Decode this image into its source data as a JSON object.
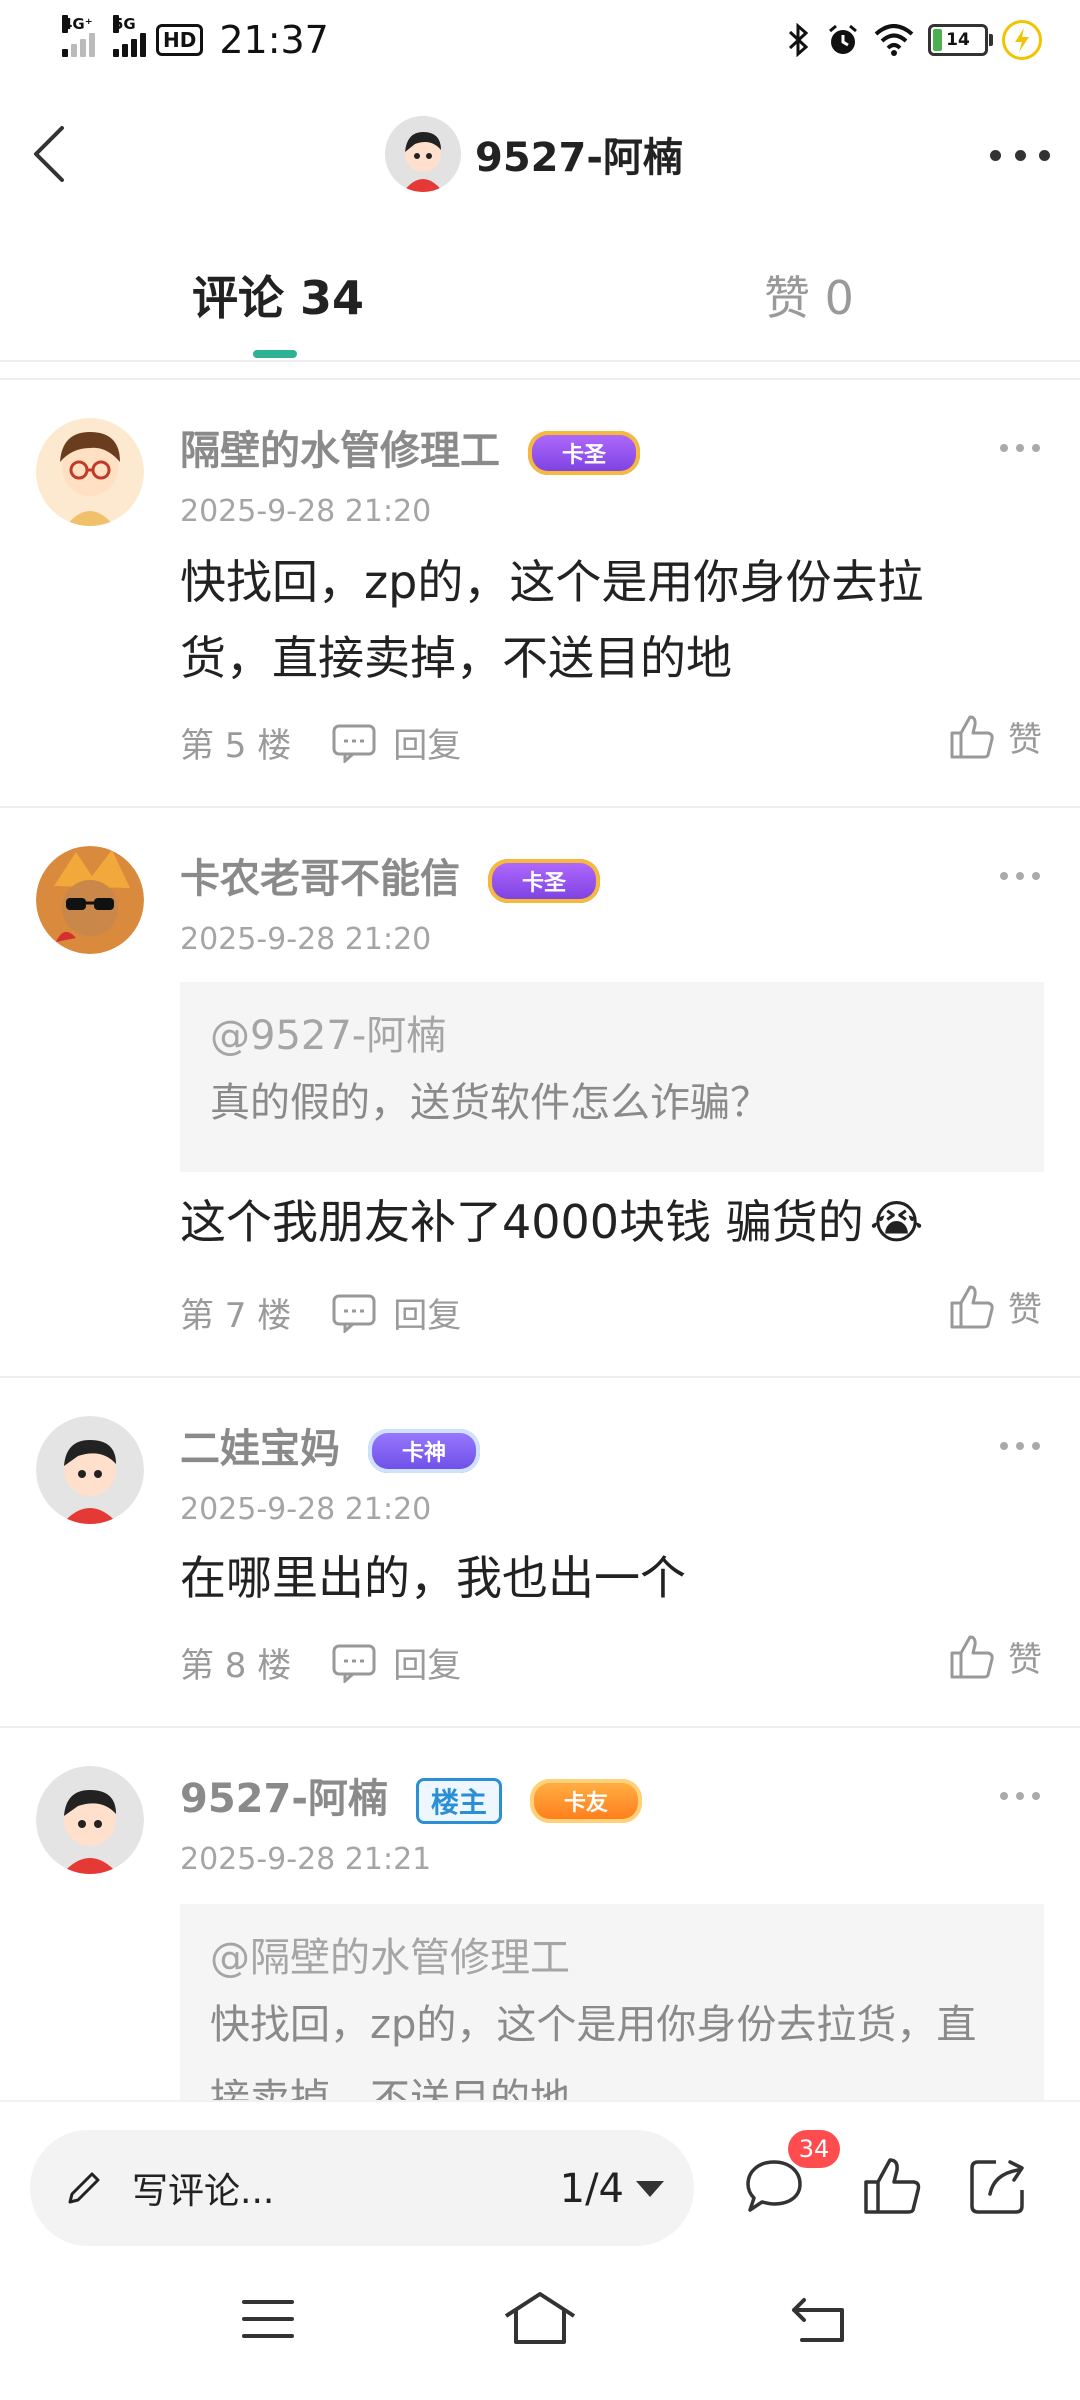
{
  "status_bar": {
    "net1": "4G⁺",
    "net2": "5G",
    "hd": "HD",
    "time": "21:37",
    "battery": "14"
  },
  "header": {
    "title": "9527-阿楠"
  },
  "tabs": [
    {
      "label": "评论 34",
      "active": true
    },
    {
      "label": "赞 0",
      "active": false
    }
  ],
  "comments": [
    {
      "name": "隔壁的水管修理工",
      "badge": "卡圣",
      "time": "2025-9-28 21:20",
      "text": "快找回，zp的，这个是用你身份去拉货，直接卖掉，不送目的地",
      "floor": "第 5 楼",
      "reply": "回复",
      "like": "赞"
    },
    {
      "name": "卡农老哥不能信",
      "badge": "卡圣",
      "time": "2025-9-28 21:20",
      "quote_at": "@9527-阿楠",
      "quote_text": "真的假的，送货软件怎么诈骗？",
      "text": "这个我朋友补了4000块钱 骗货的",
      "emoji": "😭",
      "floor": "第 7 楼",
      "reply": "回复",
      "like": "赞"
    },
    {
      "name": "二娃宝妈",
      "badge": "卡神",
      "time": "2025-9-28 21:20",
      "text": "在哪里出的，我也出一个",
      "floor": "第 8 楼",
      "reply": "回复",
      "like": "赞"
    },
    {
      "name": "9527-阿楠",
      "owner_badge": "楼主",
      "badge": "卡友",
      "time": "2025-9-28 21:21",
      "quote_at": "@隔壁的水管修理工",
      "quote_text": "快找回，zp的，这个是用你身份去拉货，直接卖掉，不送目的地"
    }
  ],
  "bottom_bar": {
    "write_placeholder": "写评论...",
    "page_indicator": "1/4",
    "comment_count": "34"
  },
  "colors": {
    "accent": "#2db394",
    "badge_red": "#ff4d4f",
    "owner_blue": "#2b8fd6"
  },
  "icons": [
    "back-arrow-icon",
    "more-icon",
    "pencil-icon",
    "comment-icon",
    "thumb-up-icon",
    "share-icon",
    "menu-icon",
    "home-icon",
    "back-nav-icon",
    "reply-icon"
  ]
}
